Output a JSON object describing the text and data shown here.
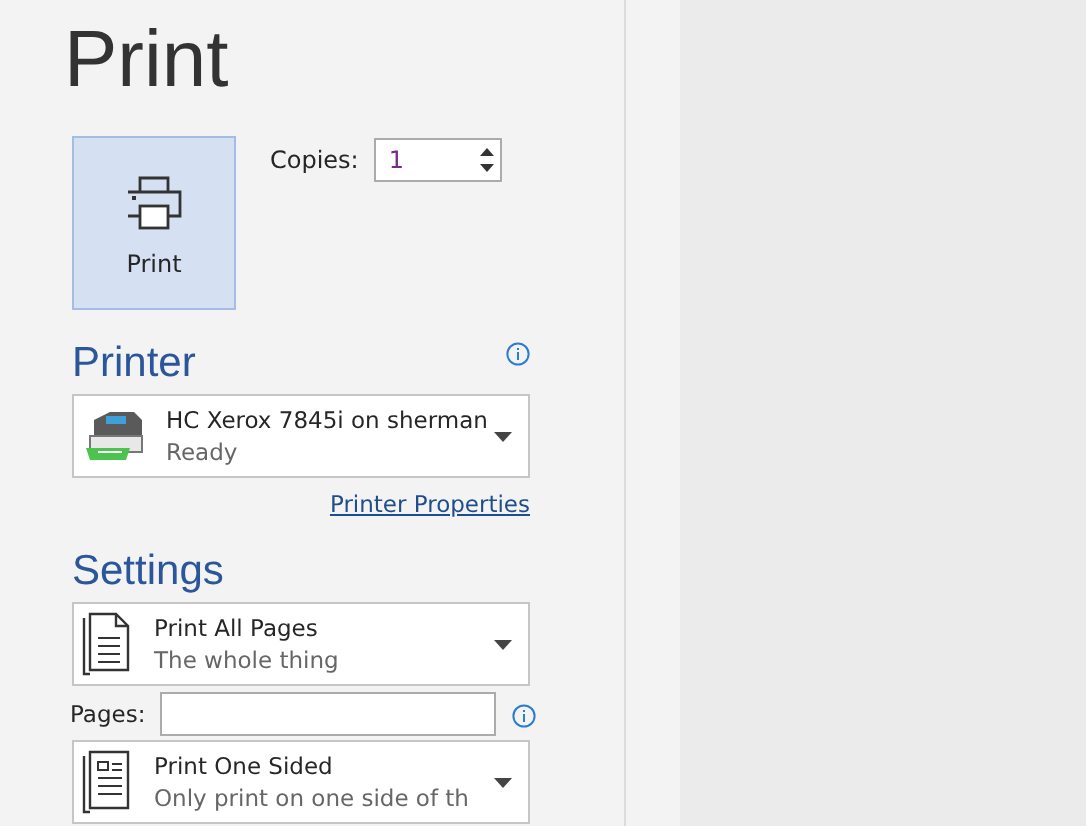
{
  "title": "Print",
  "print_button": {
    "label": "Print"
  },
  "copies": {
    "label": "Copies:",
    "value": "1"
  },
  "printer": {
    "heading": "Printer",
    "name": "HC Xerox 7845i on sherman",
    "status": "Ready",
    "properties_link": "Printer Properties"
  },
  "settings": {
    "heading": "Settings",
    "items": [
      {
        "kind": "dropdown",
        "title": "Print All Pages",
        "subtitle": "The whole thing"
      },
      {
        "kind": "field",
        "label": "Pages:"
      },
      {
        "kind": "dropdown",
        "title": "Print One Sided",
        "subtitle": "Only print on one side of th"
      }
    ]
  }
}
